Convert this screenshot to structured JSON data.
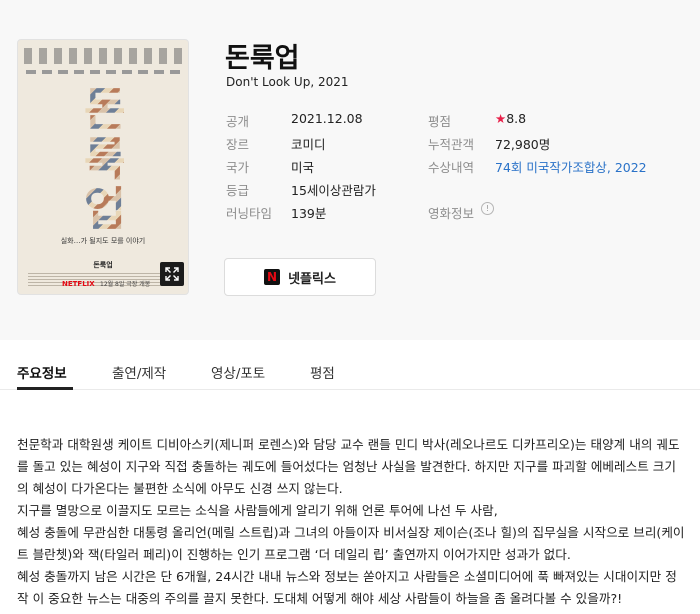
{
  "movie": {
    "title": "돈룩업",
    "subtitle": "Don't Look Up, 2021"
  },
  "poster": {
    "letters": [
      "돈",
      "룩",
      "업"
    ],
    "tagline": "실화…가 될지도 모를 이야기",
    "name": "돈룩업",
    "brand": "NETFLIX",
    "release": "12월 8일 극장 개봉",
    "expand_icon": "expand-icon"
  },
  "details_left": [
    {
      "label": "공개",
      "value": "2021.12.08"
    },
    {
      "label": "장르",
      "value": "코미디"
    },
    {
      "label": "국가",
      "value": "미국"
    },
    {
      "label": "등급",
      "value": "15세이상관람가"
    },
    {
      "label": "러닝타임",
      "value": "139분"
    }
  ],
  "details_right": {
    "rating_label": "평점",
    "rating_star": "★",
    "rating_value": "8.8",
    "audience_label": "누적관객",
    "audience_value": "72,980명",
    "awards_label": "수상내역",
    "awards_value": "74회 미국작가조합상, 2022",
    "movie_info_label": "영화정보",
    "info_icon": "!"
  },
  "watch_button": {
    "icon": "netflix-icon",
    "icon_glyph": "N",
    "label": "넷플릭스"
  },
  "tabs": [
    {
      "label": "주요정보",
      "active": true
    },
    {
      "label": "출연/제작",
      "active": false
    },
    {
      "label": "영상/포토",
      "active": false
    },
    {
      "label": "평점",
      "active": false
    }
  ],
  "synopsis": [
    "천문학과 대학원생 케이트 디비아스키(제니퍼 로렌스)와 담당 교수 랜들 민디 박사(레오나르도 디카프리오)는 태양계 내의 궤도를 돌고 있는 혜성이 지구와 직접 충돌하는 궤도에 들어섰다는 엄청난 사실을 발견한다. 하지만 지구를 파괴할 에베레스트 크기의 혜성이 다가온다는 불편한 소식에 아무도 신경 쓰지 않는다.",
    "지구를 멸망으로 이끌지도 모르는 소식을 사람들에게 알리기 위해 언론 투어에 나선 두 사람,",
    "혜성 충돌에 무관심한 대통령 올리언(메릴 스트립)과 그녀의 아들이자 비서실장 제이슨(조나 힐)의 집무실을 시작으로 브리(케이트 블란쳇)와 잭(타일러 페리)이 진행하는 인기 프로그램 ‘더 데일리 립’ 출연까지 이어가지만 성과가 없다.",
    "혜성 충돌까지 남은 시간은 단 6개월, 24시간 내내 뉴스와 정보는 쏟아지고 사람들은 소셜미디어에 푹 빠져있는 시대이지만 정작 이 중요한 뉴스는 대중의 주의를 끌지 못한다. 도대체 어떻게 해야 세상 사람들이 하늘을 좀 올려다볼 수 있을까?!"
  ]
}
